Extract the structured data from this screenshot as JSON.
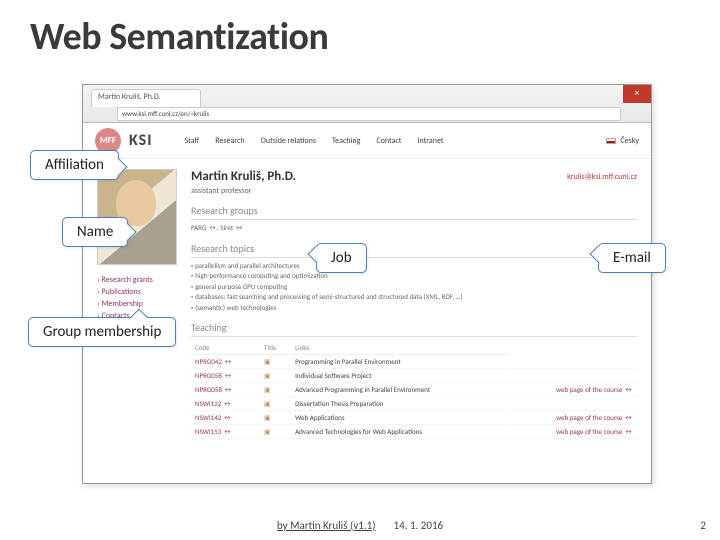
{
  "slide": {
    "title": "Web Semantization",
    "footer_credit": "by Martin Kruliš (v1.1)",
    "footer_date": "14. 1. 2016",
    "page_number": "2"
  },
  "callouts": {
    "affiliation": "Affiliation",
    "name": "Name",
    "job": "Job",
    "email": "E-mail",
    "group": "Group membership"
  },
  "browser": {
    "tab_title": "Martin Kruliš, Ph.D.",
    "url": "www.ksi.mff.cuni.cz/en/~krulis",
    "close": "×",
    "lang": "Česky"
  },
  "page": {
    "logo_text": "KSI",
    "mff_badge": "MFF",
    "nav": [
      "Staff",
      "Research",
      "Outside relations",
      "Teaching",
      "Contact",
      "Intranet"
    ],
    "person_name": "Martin Kruliš, Ph.D.",
    "job_title": "assistant professor",
    "email": "krulis@ksi.mff.cuni.cz",
    "section_groups": "Research groups",
    "groups_line": "PARG ↔, Siret ↔",
    "section_topics": "Research topics",
    "topics": [
      "parallelism and parallel architectures",
      "high-performance computing and optimization",
      "general purpose GPU computing",
      "databases: fast searching and processing of semi-structured and structured data (XML, RDF, …)",
      "(semantic) web technologies"
    ],
    "section_teaching": "Teaching",
    "side_links": [
      "Research grants",
      "Publications",
      "Membership",
      "Contacts"
    ],
    "table": {
      "headers": [
        "Code",
        "Title",
        "Links"
      ],
      "rows": [
        {
          "code": "NPRG042 ↔",
          "title": "Programming in Parallel Environment",
          "link": ""
        },
        {
          "code": "NPRG058 ↔",
          "title": "Individual Software Project",
          "link": ""
        },
        {
          "code": "NPRG058 ↔",
          "title": "Advanced Programming in Parallel Environment",
          "link": "web page of the course ↔"
        },
        {
          "code": "NSWI122 ↔",
          "title": "Dissertation Thesis Preparation",
          "link": ""
        },
        {
          "code": "NSWI142 ↔",
          "title": "Web Applications",
          "link": "web page of the course ↔"
        },
        {
          "code": "NSWI153 ↔",
          "title": "Advanced Technologies for Web Applications",
          "link": "web page of the course ↔"
        }
      ]
    }
  }
}
